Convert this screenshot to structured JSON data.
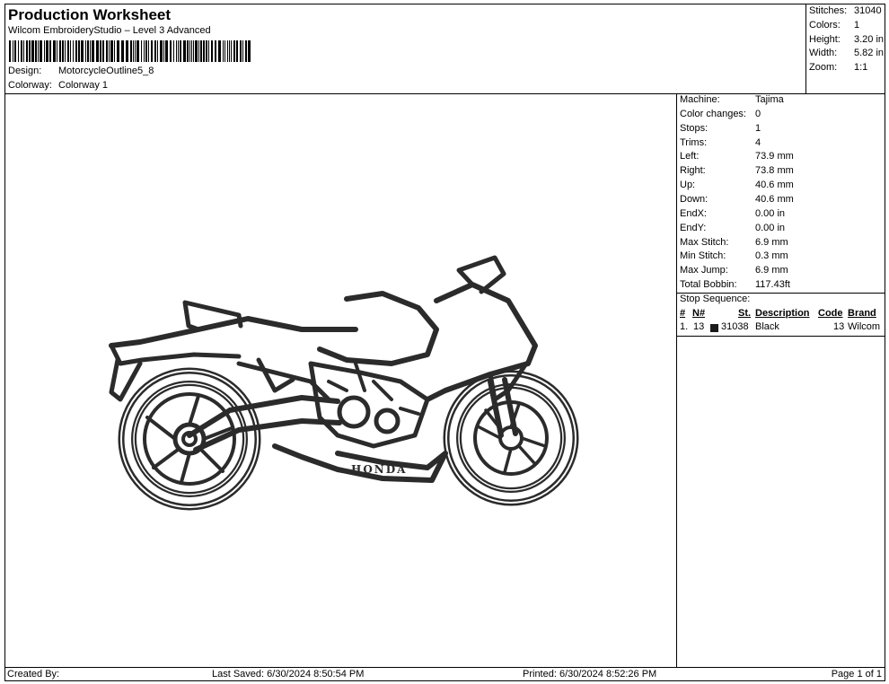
{
  "header": {
    "title": "Production Worksheet",
    "subtitle": "Wilcom EmbroideryStudio – Level 3 Advanced",
    "design_label": "Design:",
    "design_value": "MotorcycleOutline5_8",
    "colorway_label": "Colorway:",
    "colorway_value": "Colorway 1"
  },
  "summary": [
    {
      "label": "Stitches:",
      "value": "31040"
    },
    {
      "label": "Colors:",
      "value": "1"
    },
    {
      "label": "Height:",
      "value": "3.20 in"
    },
    {
      "label": "Width:",
      "value": "5.82 in"
    },
    {
      "label": "Zoom:",
      "value": "1:1"
    }
  ],
  "machine_info": [
    {
      "label": "Machine:",
      "value": "Tajima"
    },
    {
      "label": "Color changes:",
      "value": "0"
    },
    {
      "label": "Stops:",
      "value": "1"
    },
    {
      "label": "Trims:",
      "value": "4"
    },
    {
      "label": "Left:",
      "value": "73.9 mm"
    },
    {
      "label": "Right:",
      "value": "73.8 mm"
    },
    {
      "label": "Up:",
      "value": "40.6 mm"
    },
    {
      "label": "Down:",
      "value": "40.6 mm"
    },
    {
      "label": "EndX:",
      "value": "0.00 in"
    },
    {
      "label": "EndY:",
      "value": "0.00 in"
    },
    {
      "label": "Max Stitch:",
      "value": "6.9 mm"
    },
    {
      "label": "Min Stitch:",
      "value": "0.3 mm"
    },
    {
      "label": "Max Jump:",
      "value": "6.9 mm"
    },
    {
      "label": "Total Bobbin:",
      "value": "117.43ft"
    }
  ],
  "stop_sequence": {
    "title": "Stop Sequence:",
    "columns": {
      "index": "#",
      "needle": "N#",
      "stitches": "St.",
      "description": "Description",
      "code": "Code",
      "brand": "Brand"
    },
    "rows": [
      {
        "index": "1.",
        "needle": "13",
        "swatch_color": "#1a1a1a",
        "stitches": "31038",
        "description": "Black",
        "code": "13",
        "brand": "Wilcom"
      }
    ]
  },
  "design": {
    "thread_color": "#2b2b2b",
    "brand_text": "HONDA"
  },
  "footer": {
    "created_by": "Created By:",
    "last_saved": "Last Saved: 6/30/2024 8:50:54 PM",
    "printed": "Printed: 6/30/2024 8:52:26 PM",
    "page": "Page 1 of 1"
  }
}
